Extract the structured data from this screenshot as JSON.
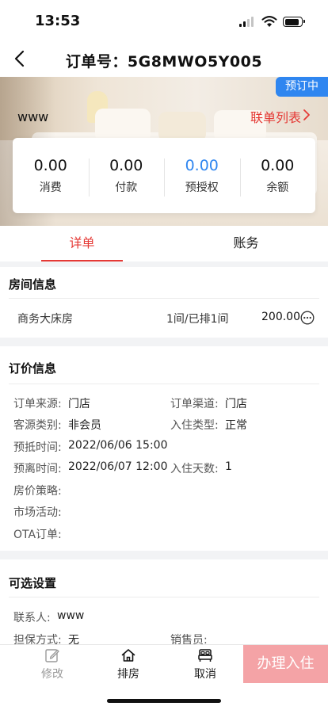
{
  "status_bar": {
    "time": "13:53"
  },
  "nav": {
    "title": "订单号：5G8MWO5Y005"
  },
  "header": {
    "status_badge": "预订中",
    "guest_name": "www",
    "linked_list_label": "联单列表"
  },
  "summary": {
    "items": [
      {
        "value": "0.00",
        "label": "消费"
      },
      {
        "value": "0.00",
        "label": "付款"
      },
      {
        "value": "0.00",
        "label": "预授权"
      },
      {
        "value": "0.00",
        "label": "余额"
      }
    ]
  },
  "tabs": [
    {
      "label": "详单",
      "active": true
    },
    {
      "label": "账务",
      "active": false
    }
  ],
  "room_info": {
    "title": "房间信息",
    "rows": [
      {
        "room_type": "商务大床房",
        "count": "1间/已排1间",
        "price": "200.00"
      }
    ]
  },
  "pricing_info": {
    "title": "订价信息",
    "fields": {
      "order_source": {
        "label": "订单来源:",
        "value": "门店"
      },
      "order_channel": {
        "label": "订单渠道:",
        "value": "门店"
      },
      "guest_category": {
        "label": "客源类别:",
        "value": "非会员"
      },
      "checkin_type": {
        "label": "入住类型:",
        "value": "正常"
      },
      "arrival_time": {
        "label": "预抵时间:",
        "value": "2022/06/06 15:00"
      },
      "departure_time": {
        "label": "预离时间:",
        "value": "2022/06/07 12:00"
      },
      "stay_days": {
        "label": "入住天数:",
        "value": "1"
      },
      "rate_policy": {
        "label": "房价策略:",
        "value": ""
      },
      "market_activity": {
        "label": "市场活动:",
        "value": ""
      },
      "ota_order": {
        "label": "OTA订单:",
        "value": ""
      }
    }
  },
  "optional_settings": {
    "title": "可选设置",
    "fields": {
      "contact": {
        "label": "联系人:",
        "value": "www"
      },
      "guarantee": {
        "label": "担保方式:",
        "value": "无"
      },
      "salesperson": {
        "label": "销售员:",
        "value": ""
      }
    }
  },
  "bottom_bar": {
    "edit_label": "修改",
    "arrange_label": "排房",
    "cancel_label": "取消",
    "checkin_label": "办理入住"
  },
  "colors": {
    "accent_red": "#e53935",
    "badge_blue": "#2f86f0",
    "checkin_pink": "#f4a3a6"
  }
}
